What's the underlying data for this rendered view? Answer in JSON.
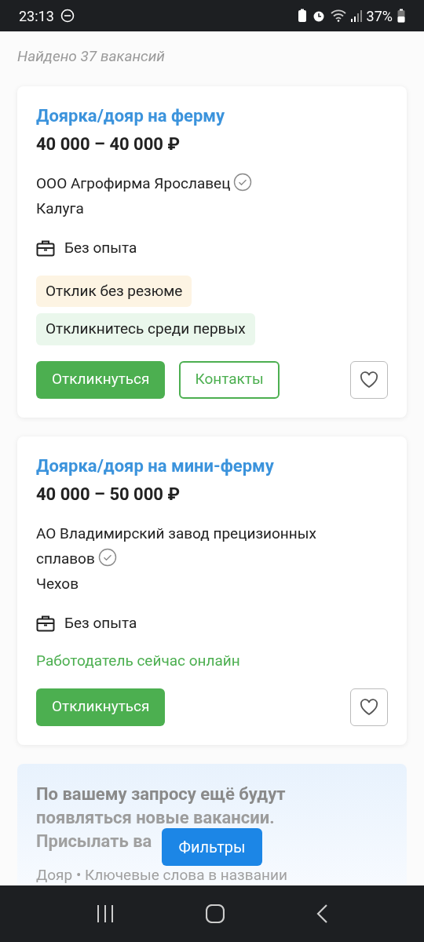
{
  "status_bar": {
    "time": "23:13",
    "battery": "37%"
  },
  "found_count": "Найдено 37 вакансий",
  "vacancies": [
    {
      "title": "Доярка/дояр на ферму",
      "salary": "40 000 – 40 000 ₽",
      "company": "ООО Агрофирма Ярославец",
      "verified": true,
      "city": "Калуга",
      "experience": "Без опыта",
      "tags": [
        {
          "label": "Отклик без резюме",
          "color": "#fdf4e3"
        },
        {
          "label": "Откликнитесь среди первых",
          "color": "#eaf7ec"
        }
      ],
      "respond_label": "Откликнуться",
      "contacts_label": "Контакты",
      "favorite": false
    },
    {
      "title": "Доярка/дояр на мини-ферму",
      "salary": "40 000 – 50 000 ₽",
      "company": "АО Владимирский завод прецизионных сплавов",
      "verified": true,
      "city": "Чехов",
      "experience": "Без опыта",
      "online_note": "Работодатель сейчас онлайн",
      "respond_label": "Откликнуться",
      "favorite": false
    }
  ],
  "subscription": {
    "title_lines": [
      "По вашему запросу ещё будут",
      "появляться новые вакансии.",
      "Присылать ва"
    ],
    "subtitle": "Дояр • Ключевые слова в названии"
  },
  "filters_button": "Фильтры"
}
